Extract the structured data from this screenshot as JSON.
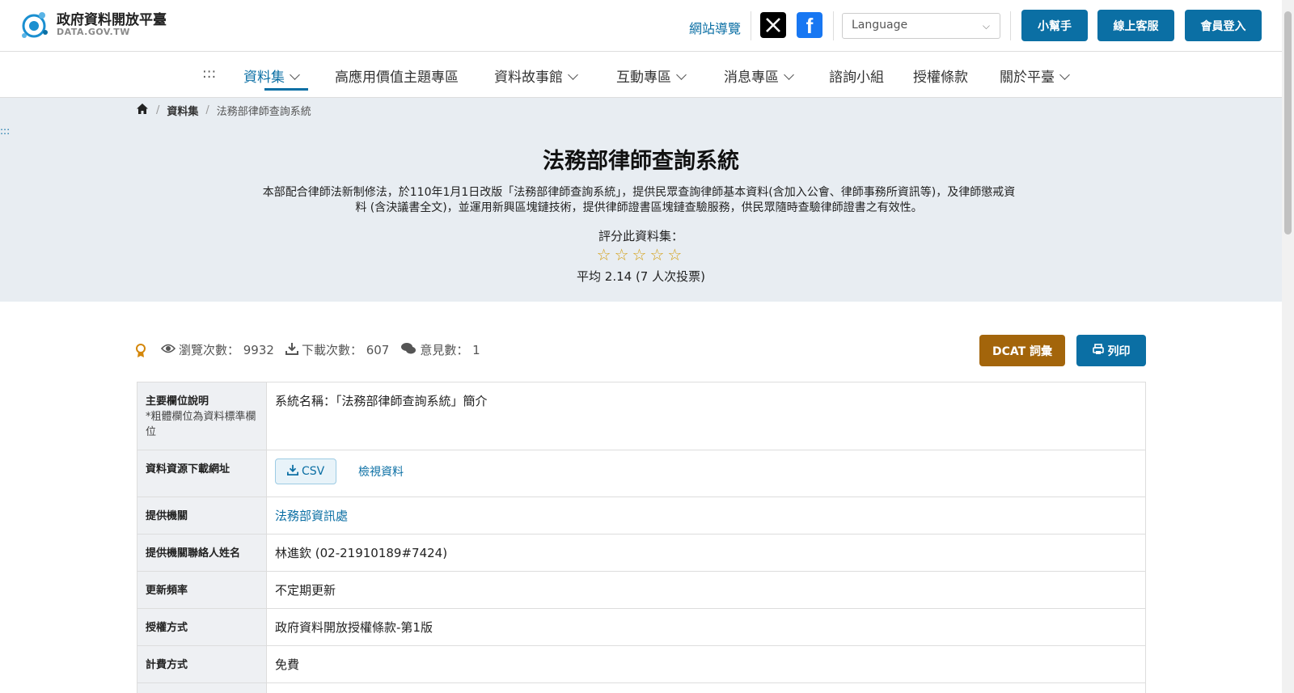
{
  "header": {
    "logo_title": "政府資料開放平臺",
    "logo_sub": "DATA.GOV.TW",
    "sitemap_link": "網站導覽",
    "language_placeholder": "Language",
    "btn_helper": "小幫手",
    "btn_support": "線上客服",
    "btn_login": "會員登入"
  },
  "nav": {
    "menu_dots": ":::",
    "items": [
      {
        "label": "資料集"
      },
      {
        "label": "高應用價值主題專區"
      },
      {
        "label": "資料故事館"
      },
      {
        "label": "互動專區"
      },
      {
        "label": "消息專區"
      },
      {
        "label": "諮詢小組"
      },
      {
        "label": "授權條款"
      },
      {
        "label": "關於平臺"
      }
    ]
  },
  "breadcrumb": {
    "level1": "資料集",
    "current": "法務部律師查詢系統"
  },
  "hero": {
    "skip_marker": ":::",
    "title": "法務部律師查詢系統",
    "description": "本部配合律師法新制修法，於110年1月1日改版「法務部律師查詢系統」，提供民眾查詢律師基本資料(含加入公會、律師事務所資訊等)，及律師懲戒資料 (含決議書全文)，並運用新興區塊鏈技術，提供律師證書區塊鏈查驗服務，供民眾隨時查驗律師證書之有效性。",
    "rate_label": "評分此資料集：",
    "stars": "☆☆☆☆☆",
    "average": "平均 2.14 (7 人次投票)"
  },
  "stats": {
    "views": "瀏覽次數： 9932",
    "downloads": "下載次數： 607",
    "comments": "意見數： 1",
    "btn_dcat": "DCAT 詞彙",
    "btn_print": "列印"
  },
  "table": {
    "rows": [
      {
        "key": "主要欄位說明",
        "note": "*粗體欄位為資料標準欄位",
        "value": "系統名稱：｢法務部律師查詢系統」簡介"
      },
      {
        "key": "資料資源下載網址",
        "csv": "CSV",
        "view": "檢視資料"
      },
      {
        "key": "提供機關",
        "value": "法務部資訊處"
      },
      {
        "key": "提供機關聯絡人姓名",
        "value": "林進欽 (02-21910189#7424)"
      },
      {
        "key": "更新頻率",
        "value": "不定期更新"
      },
      {
        "key": "授權方式",
        "value": "政府資料開放授權條款-第1版"
      },
      {
        "key": "計費方式",
        "value": "免費"
      },
      {
        "key": "",
        "value": ""
      }
    ]
  }
}
